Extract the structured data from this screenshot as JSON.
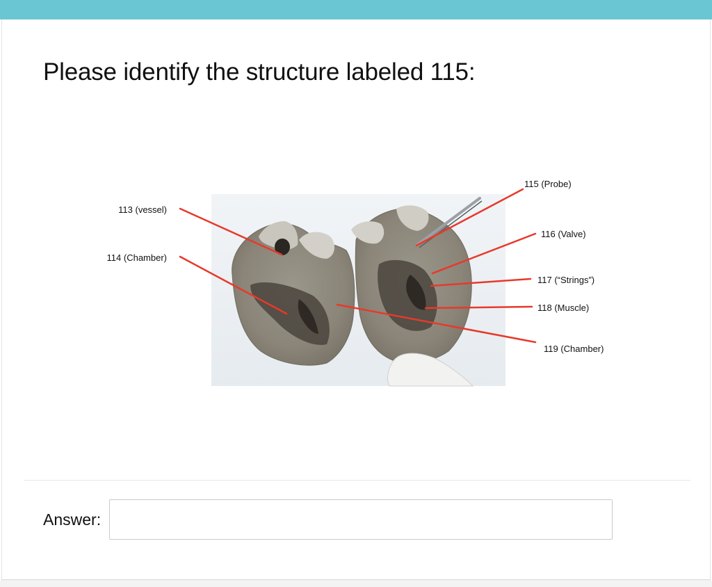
{
  "question": {
    "text": "Please identify the structure labeled 115:"
  },
  "figure": {
    "labels": {
      "l113": "113 (vessel)",
      "l114": "114 (Chamber)",
      "l115": "115 (Probe)",
      "l116": "116 (Valve)",
      "l117": "117 (“Strings”)",
      "l118": "118 (Muscle)",
      "l119": "119 (Chamber)"
    },
    "colors": {
      "leader_line": "#e8392b",
      "heart_tissue": "#8f8a7d",
      "photo_background": "#eef2f6"
    }
  },
  "answer": {
    "label": "Answer:",
    "value": ""
  },
  "colors": {
    "top_bar": "#6bc6d3"
  }
}
